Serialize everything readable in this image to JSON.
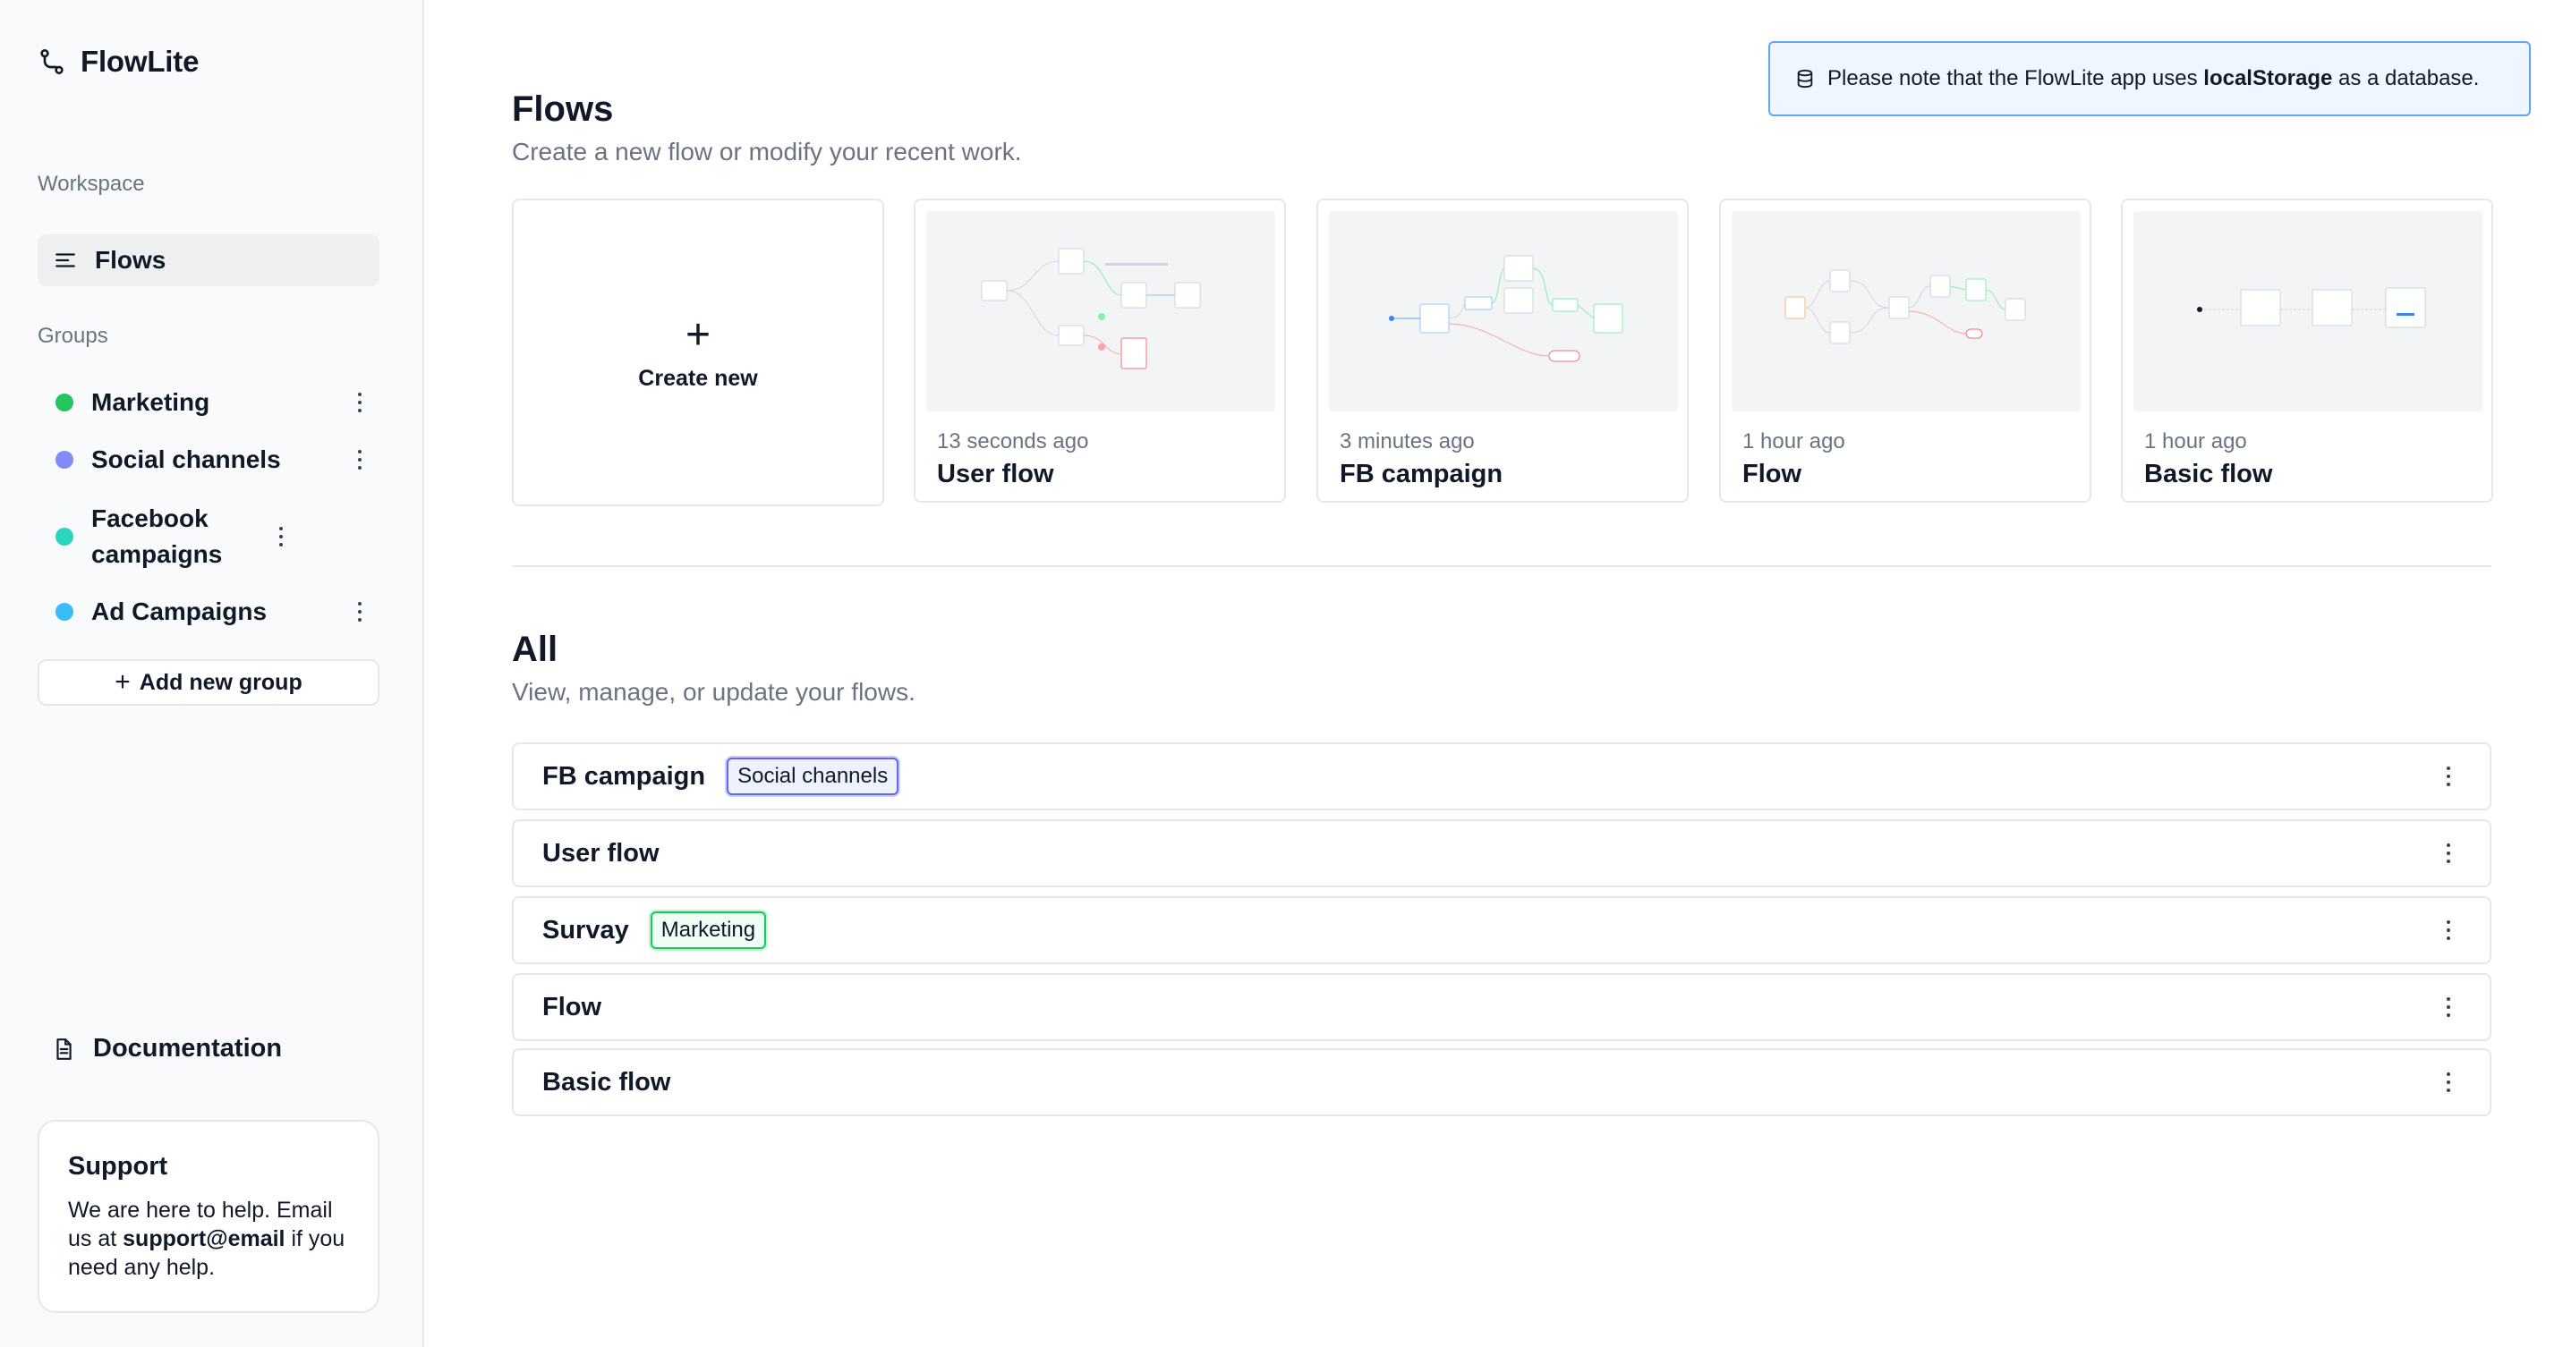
{
  "app": {
    "name": "FlowLite"
  },
  "sidebar": {
    "workspace_label": "Workspace",
    "nav": [
      {
        "label": "Flows",
        "icon": "list-icon"
      }
    ],
    "groups_label": "Groups",
    "groups": [
      {
        "label": "Marketing",
        "color": "#22c55e"
      },
      {
        "label": "Social channels",
        "color": "#818cf8"
      },
      {
        "label": "Facebook campaigns",
        "color": "#2dd4bf"
      },
      {
        "label": "Ad Campaigns",
        "color": "#38bdf8"
      }
    ],
    "add_group_label": "Add new group",
    "documentation_label": "Documentation",
    "support": {
      "title": "Support",
      "text_before": "We are here to help. Email us at ",
      "email": "support@email",
      "text_after": " if you need any help."
    }
  },
  "notice": {
    "text_before": "Please note that the FlowLite app uses ",
    "emphasis": "localStorage",
    "text_after": " as a database."
  },
  "recent": {
    "title": "Flows",
    "subtitle": "Create a new flow or modify your recent work.",
    "create_label": "Create new",
    "cards": [
      {
        "time": "13 seconds ago",
        "title": "User flow"
      },
      {
        "time": "3 minutes ago",
        "title": "FB campaign"
      },
      {
        "time": "1 hour ago",
        "title": "Flow"
      },
      {
        "time": "1 hour ago",
        "title": "Basic flow"
      }
    ]
  },
  "all": {
    "title": "All",
    "subtitle": "View, manage, or update your flows.",
    "rows": [
      {
        "name": "FB campaign",
        "tag": "Social channels"
      },
      {
        "name": "User flow",
        "tag": ""
      },
      {
        "name": "Survay",
        "tag": "Marketing"
      },
      {
        "name": "Flow",
        "tag": ""
      },
      {
        "name": "Basic flow",
        "tag": ""
      }
    ]
  },
  "colors": {
    "accent_blue": "#60a5fa",
    "tag_blue": "#6366f1",
    "tag_green": "#22c55e"
  }
}
